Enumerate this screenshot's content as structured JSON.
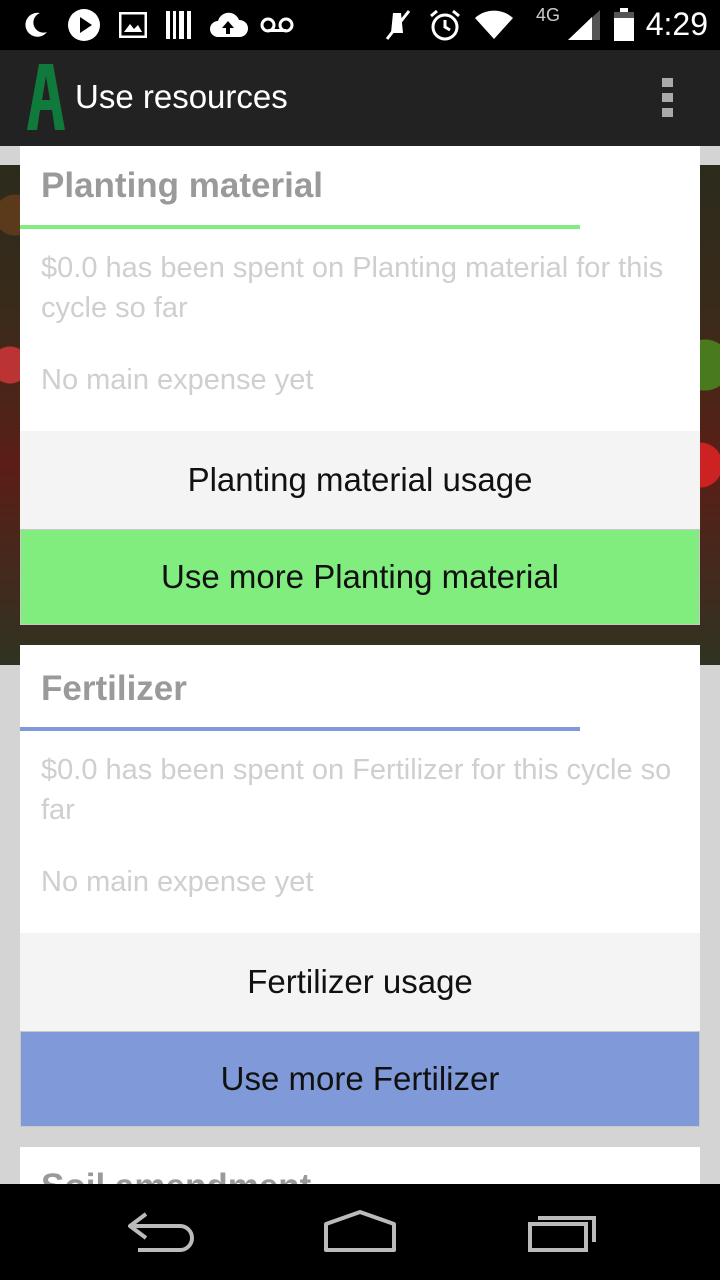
{
  "status_bar": {
    "time": "4:29",
    "network": "4G",
    "icons": [
      "moon-icon",
      "play-icon",
      "image-icon",
      "barcode-icon",
      "cloud-upload-icon",
      "voicemail-icon",
      "mute-icon",
      "alarm-icon",
      "wifi-icon",
      "signal-icon",
      "battery-icon"
    ]
  },
  "action_bar": {
    "logo_letter": "A",
    "title": "Use resources",
    "overflow_icon": "more-vert-icon"
  },
  "colors": {
    "planting_accent": "#80ed7e",
    "fertilizer_accent": "#8099d9",
    "logo_green": "#0f7a3c"
  },
  "cards": [
    {
      "title": "Planting material",
      "description": "$0.0 has been spent on Planting material for this cycle so far",
      "expense": "No main expense yet",
      "usage_label": "Planting material usage",
      "use_more_label": "Use more Planting material"
    },
    {
      "title": "Fertilizer",
      "description": "$0.0 has been spent on Fertilizer for this cycle so far",
      "expense": "No main expense yet",
      "usage_label": "Fertilizer usage",
      "use_more_label": "Use more Fertilizer"
    },
    {
      "title": "Soil amendment"
    }
  ],
  "nav_bar": {
    "icons": [
      "back-icon",
      "home-icon",
      "recent-apps-icon"
    ]
  }
}
